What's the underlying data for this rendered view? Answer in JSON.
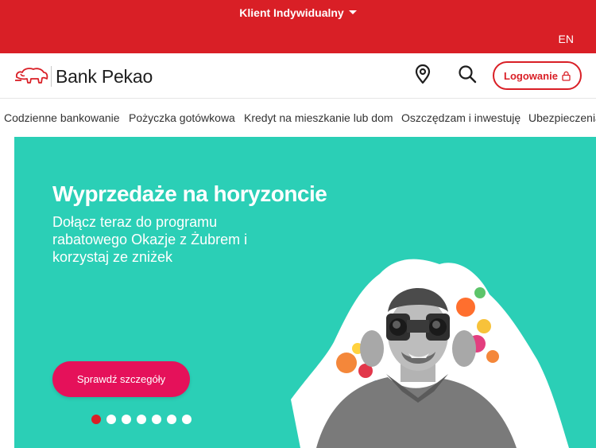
{
  "topbar": {
    "segment_label": "Klient Indywidualny",
    "lang_label": "EN",
    "bg_color": "#d91f26"
  },
  "header": {
    "brand_name": "Bank Pekao",
    "logo_icon": "bison-logo-icon",
    "location_icon": "location-pin-icon",
    "search_icon": "search-icon",
    "login_label": "Logowanie",
    "login_icon": "lock-icon"
  },
  "nav": {
    "items": [
      {
        "label": "Codzienne bankowanie"
      },
      {
        "label": "Pożyczka gotówkowa"
      },
      {
        "label": "Kredyt na mieszkanie lub dom"
      },
      {
        "label": "Oszczędzam i inwestuję"
      },
      {
        "label": "Ubezpieczenia"
      }
    ]
  },
  "hero": {
    "title": "Wyprzedaże na horyzoncie",
    "subtitle": "Dołącz teraz do programu rabatowego Okazje z Żubrem i korzystaj ze zniżek",
    "cta_label": "Sprawdź szczegóły",
    "bg_color": "#2bcfb6",
    "cta_color": "#e5115a",
    "slides_count": 7,
    "active_slide": 1
  }
}
